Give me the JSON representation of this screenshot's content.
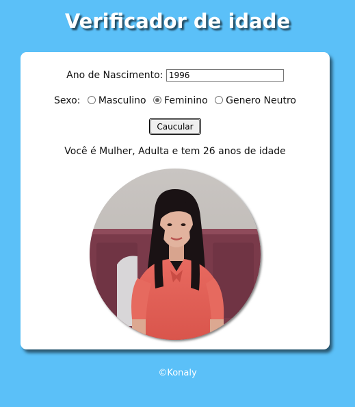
{
  "header": {
    "title": "Verificador de idade"
  },
  "form": {
    "year_label": "Ano de Nascimento:",
    "year_value": "1996",
    "sex_label": "Sexo:",
    "sex_options": [
      "Masculino",
      "Feminino",
      "Genero Neutro"
    ],
    "sex_selected": "Feminino",
    "submit_label": "Caucular"
  },
  "result": {
    "text": "Você é Mulher, Adulta e tem 26 anos de idade",
    "photo_icon": "woman-portrait-photo"
  },
  "footer": {
    "text": "©Konaly"
  },
  "colors": {
    "background": "#5bc0f8",
    "card": "#ffffff"
  }
}
